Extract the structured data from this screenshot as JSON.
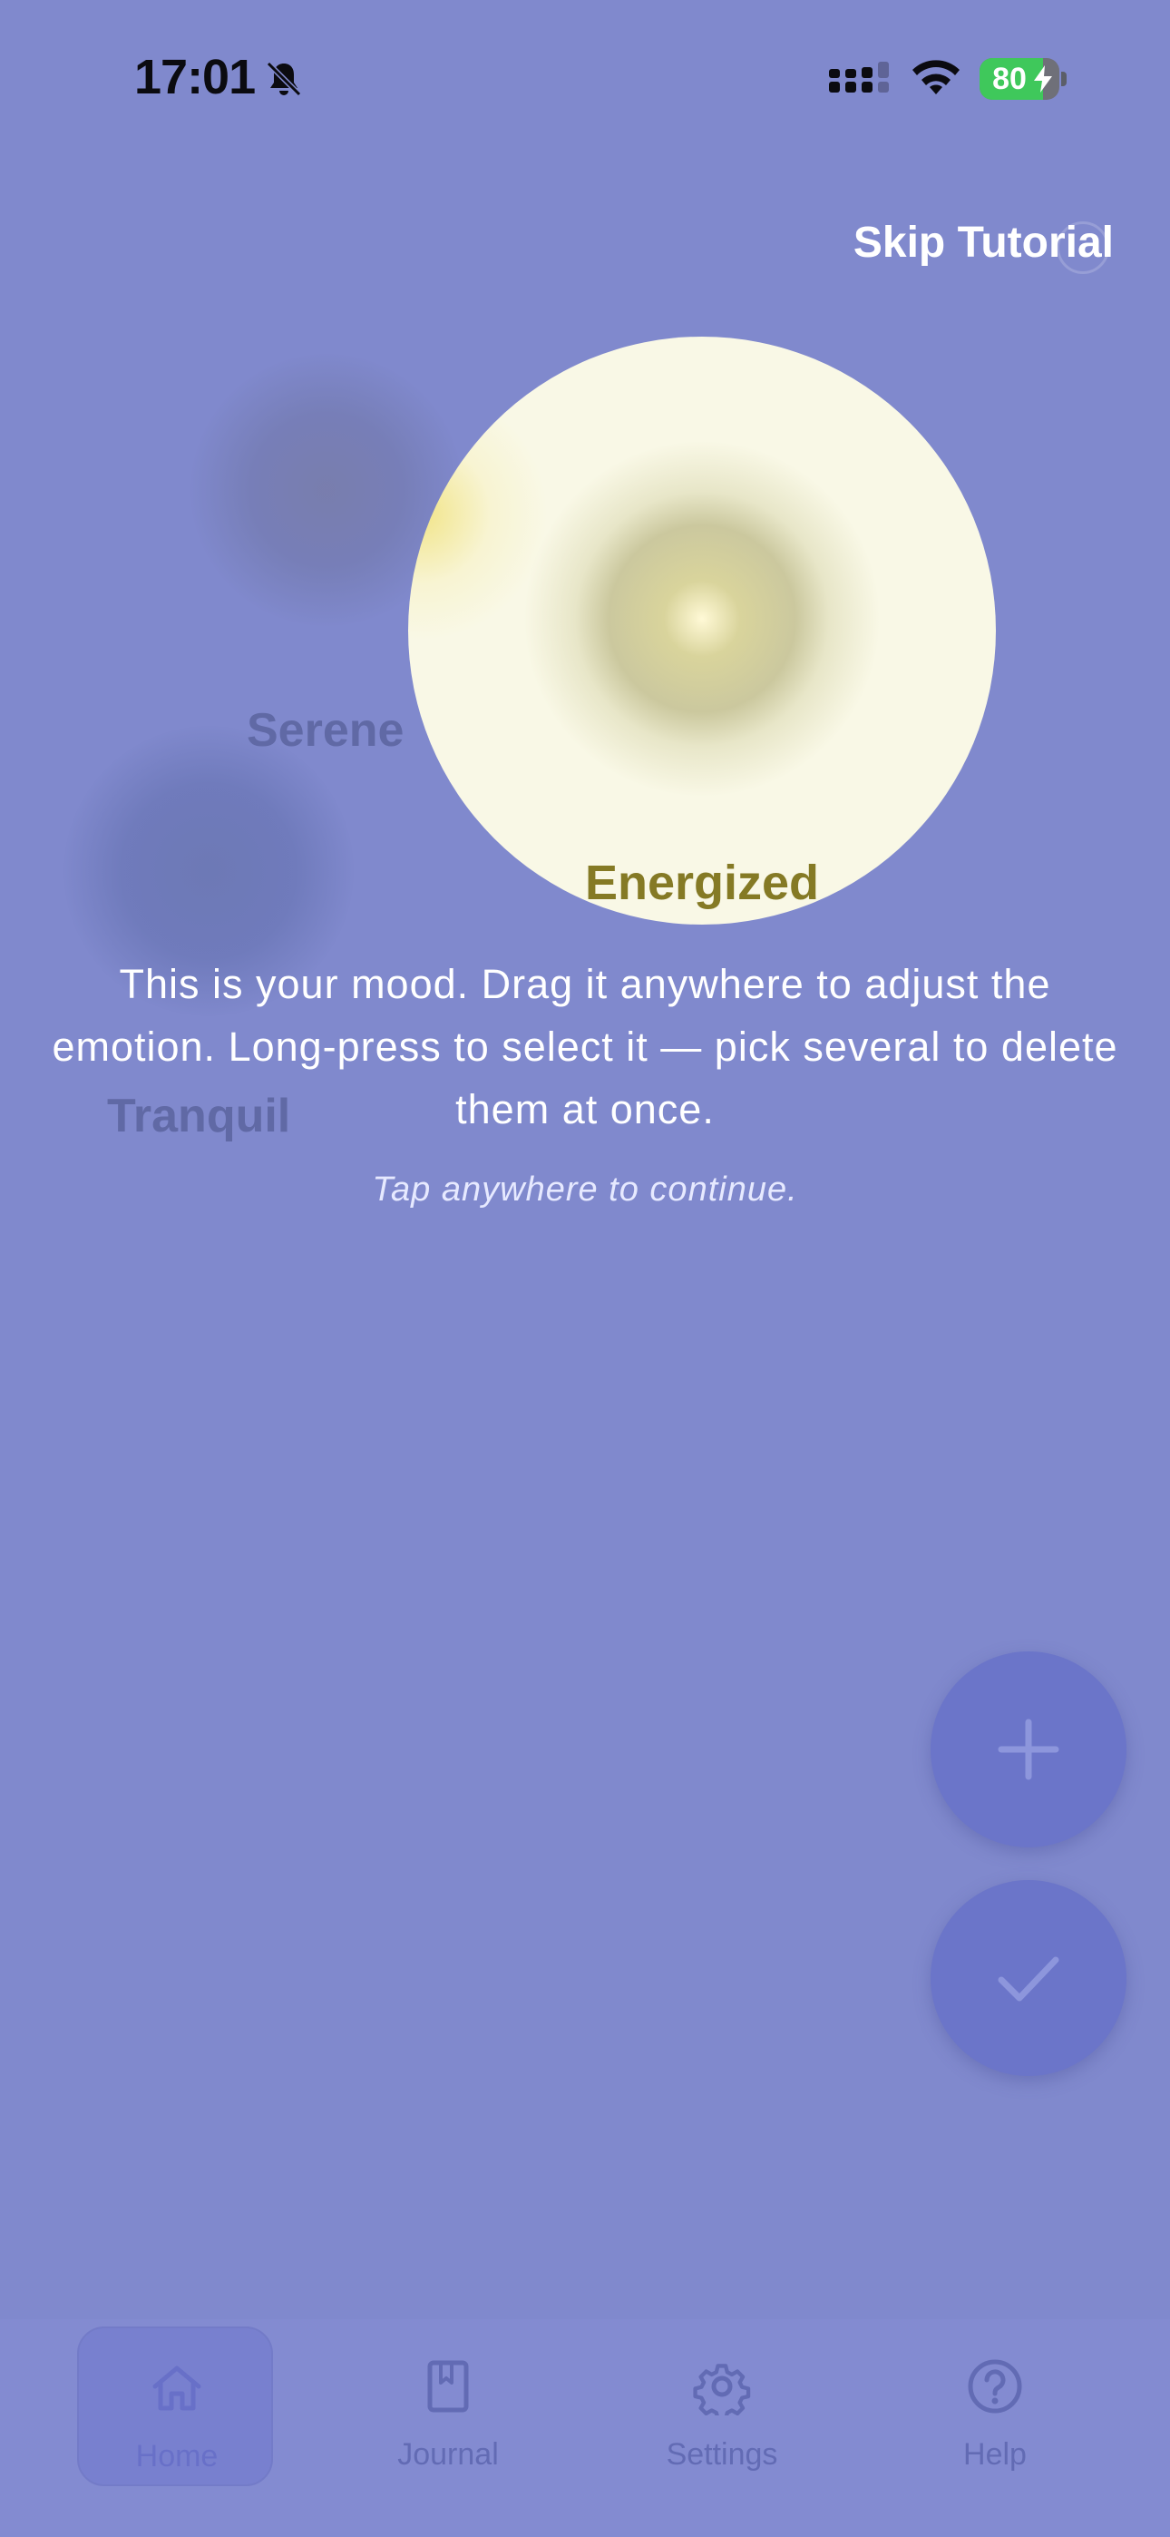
{
  "status_bar": {
    "time": "17:01",
    "battery_percent": "80",
    "battery_level": 0.8,
    "icons": [
      "bell-slash-icon",
      "cellular-signal-icon",
      "wifi-icon",
      "battery-charging-icon"
    ]
  },
  "tutorial": {
    "skip_label": "Skip Tutorial",
    "message": "This is your mood. Drag it anywhere to adjust the emotion. Long-press to select it — pick several to delete them at once.",
    "hint": "Tap anywhere to continue."
  },
  "moods": {
    "highlighted": {
      "label": "Energized",
      "color": "#f9f8e6",
      "text_color": "#857a25"
    },
    "dimmed": [
      {
        "label": "Serene"
      },
      {
        "label": "Tranquil"
      }
    ]
  },
  "fabs": {
    "add_icon": "plus-icon",
    "confirm_icon": "check-icon",
    "color": "#6b75c9"
  },
  "nav": {
    "items": [
      {
        "label": "Home",
        "icon": "home-icon",
        "active": true
      },
      {
        "label": "Journal",
        "icon": "bookmark-book-icon",
        "active": false
      },
      {
        "label": "Settings",
        "icon": "gear-icon",
        "active": false
      },
      {
        "label": "Help",
        "icon": "help-circle-icon",
        "active": false
      }
    ]
  },
  "colors": {
    "overlay_background": "#8089cd",
    "nav_background": "#838bd1",
    "accent": "#6b75c9"
  }
}
